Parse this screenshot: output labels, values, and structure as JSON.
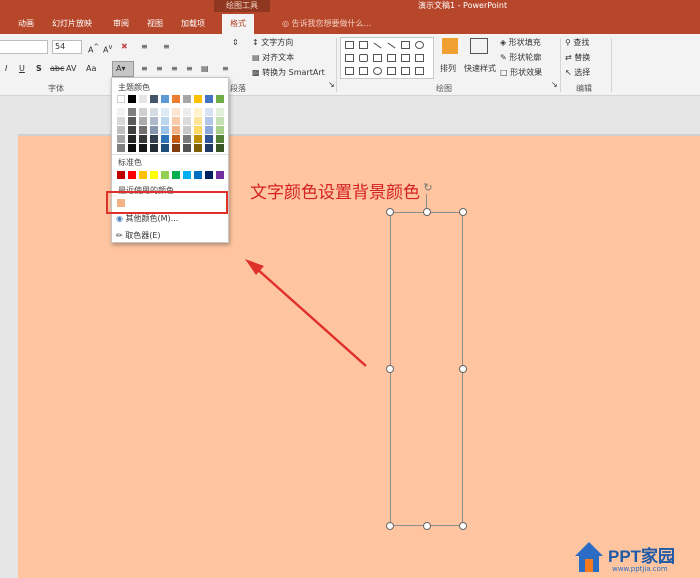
{
  "titlebar": {
    "context_tab": "绘图工具",
    "document_title": "演示文稿1 - PowerPoint",
    "tabs": [
      "动画",
      "幻灯片放映",
      "审阅",
      "视图",
      "加载项",
      "格式"
    ],
    "tell_me": "告诉我您想要做什么..."
  },
  "ribbon": {
    "font_name": "",
    "font_size": "54",
    "groups": {
      "font": "字体",
      "paragraph_partial": "段落",
      "drawing": "绘图",
      "editing": "编辑"
    },
    "paragraph": {
      "text_direction": "文字方向",
      "align_text": "对齐文本",
      "convert_smartart": "转换为 SmartArt"
    },
    "drawing": {
      "arrange": "排列",
      "quick_styles": "快速样式",
      "shape_fill": "形状填充",
      "shape_outline": "形状轮廓",
      "shape_effects": "形状效果"
    },
    "editing": {
      "find": "查找",
      "replace": "替换",
      "select": "选择"
    }
  },
  "dropdown": {
    "theme_colors_label": "主题颜色",
    "standard_colors_label": "标准色",
    "recent_colors_label": "最近使用的颜色",
    "more_colors": "其他颜色(M)...",
    "eyedropper": "取色器(E)",
    "theme_top": [
      "#ffffff",
      "#000000",
      "#e7e6e6",
      "#44546a",
      "#5b9bd5",
      "#ed7d31",
      "#a5a5a5",
      "#ffc000",
      "#4472c4",
      "#70ad47"
    ],
    "theme_shades": [
      [
        "#f2f2f2",
        "#7f7f7f",
        "#d0cece",
        "#d6dce4",
        "#deebf6",
        "#fbe5d5",
        "#ededed",
        "#fff2cc",
        "#d9e2f3",
        "#e2efd9"
      ],
      [
        "#d8d8d8",
        "#595959",
        "#aeabab",
        "#adb9ca",
        "#bdd7ee",
        "#f7cbac",
        "#dbdbdb",
        "#fee599",
        "#b4c6e7",
        "#c5e0b3"
      ],
      [
        "#bfbfbf",
        "#3f3f3f",
        "#757070",
        "#8496b0",
        "#9cc3e5",
        "#f4b183",
        "#c9c9c9",
        "#ffd965",
        "#8eaadb",
        "#a8d08d"
      ],
      [
        "#a5a5a5",
        "#262626",
        "#3a3838",
        "#323f4f",
        "#2e75b5",
        "#c55a11",
        "#7b7b7b",
        "#bf9000",
        "#2f5496",
        "#538135"
      ],
      [
        "#7f7f7f",
        "#0c0c0c",
        "#171616",
        "#222a35",
        "#1e4e79",
        "#833c0b",
        "#525252",
        "#7f6000",
        "#1f3864",
        "#375623"
      ]
    ],
    "standard": [
      "#c00000",
      "#ff0000",
      "#ffc000",
      "#ffff00",
      "#92d050",
      "#00b050",
      "#00b0f0",
      "#0070c0",
      "#002060",
      "#7030a0"
    ],
    "recent": [
      "#f4b183"
    ]
  },
  "slide": {
    "background": "#fec5a0",
    "title": "文字颜色设置背景颜色"
  },
  "watermark": {
    "brand": "PPT家园",
    "url": "www.pptjia.com"
  }
}
